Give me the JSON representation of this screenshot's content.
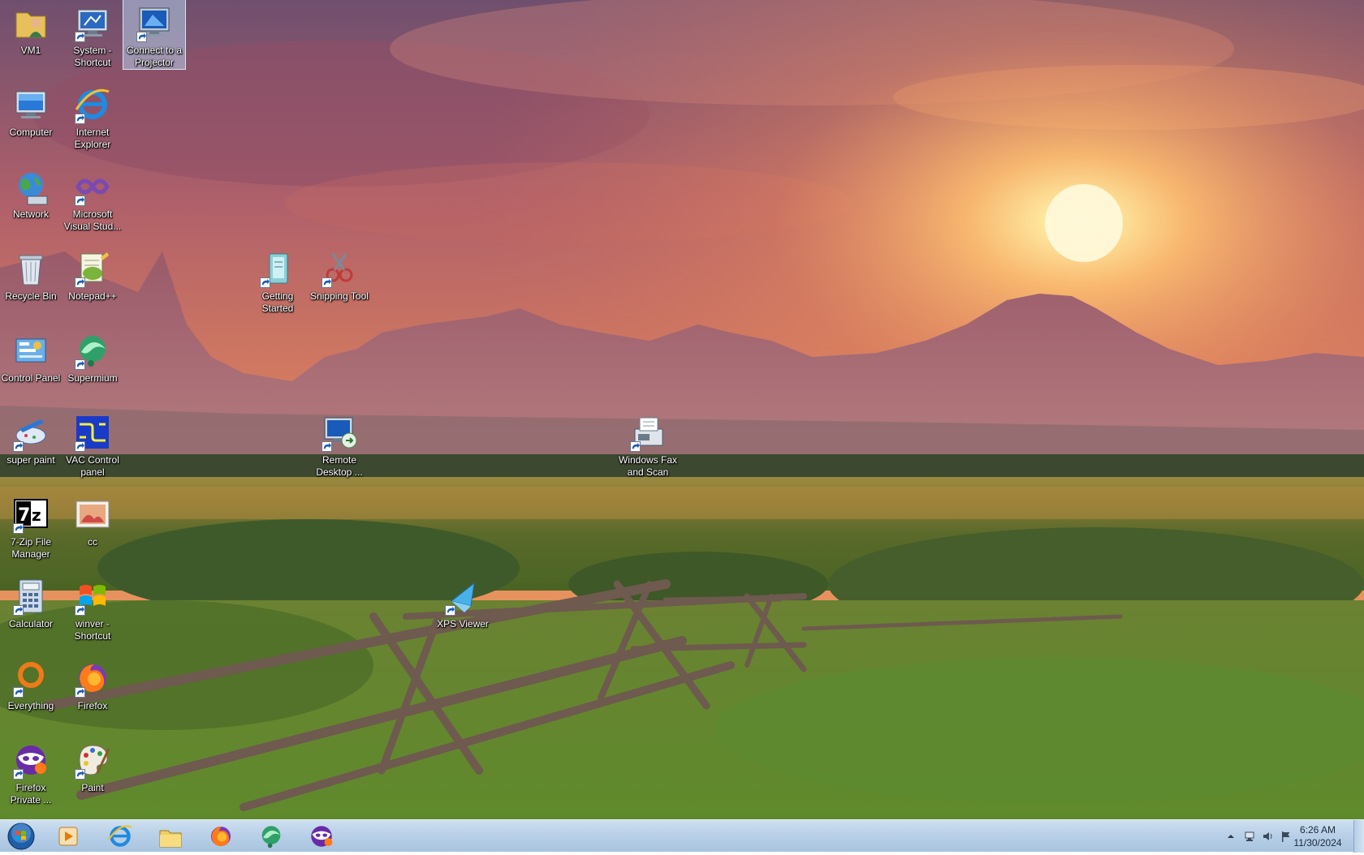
{
  "desktop": {
    "icons": [
      {
        "label": "VM1",
        "icon": "user-folder-icon",
        "shortcut": false,
        "selected": false
      },
      {
        "label": "System - Shortcut",
        "icon": "system-monitor-icon",
        "shortcut": true,
        "selected": false
      },
      {
        "label": "Connect to a Projector",
        "icon": "projector-monitor-icon",
        "shortcut": true,
        "selected": true
      },
      {
        "label": "Computer",
        "icon": "computer-icon",
        "shortcut": false,
        "selected": false
      },
      {
        "label": "Internet Explorer",
        "icon": "internet-explorer-icon",
        "shortcut": true,
        "selected": false
      },
      {
        "label": "Network",
        "icon": "network-globe-icon",
        "shortcut": false,
        "selected": false
      },
      {
        "label": "Microsoft Visual Stud...",
        "icon": "visual-studio-icon",
        "shortcut": true,
        "selected": false
      },
      {
        "label": "Recycle Bin",
        "icon": "recycle-bin-icon",
        "shortcut": false,
        "selected": false
      },
      {
        "label": "Notepad++",
        "icon": "notepad-plus-plus-icon",
        "shortcut": true,
        "selected": false
      },
      {
        "label": "Getting Started",
        "icon": "getting-started-icon",
        "shortcut": true,
        "selected": false
      },
      {
        "label": "Snipping Tool",
        "icon": "snipping-tool-icon",
        "shortcut": true,
        "selected": false
      },
      {
        "label": "Control Panel",
        "icon": "control-panel-icon",
        "shortcut": false,
        "selected": false
      },
      {
        "label": "Supermium",
        "icon": "supermium-icon",
        "shortcut": true,
        "selected": false
      },
      {
        "label": "super paint",
        "icon": "super-paint-icon",
        "shortcut": true,
        "selected": false
      },
      {
        "label": "VAC Control panel",
        "icon": "vac-control-icon",
        "shortcut": true,
        "selected": false
      },
      {
        "label": "Remote Desktop ...",
        "icon": "remote-desktop-icon",
        "shortcut": true,
        "selected": false
      },
      {
        "label": "Windows Fax and Scan",
        "icon": "fax-scan-icon",
        "shortcut": true,
        "selected": false
      },
      {
        "label": "7-Zip File Manager",
        "icon": "seven-zip-icon",
        "shortcut": true,
        "selected": false
      },
      {
        "label": "cc",
        "icon": "image-file-icon",
        "shortcut": false,
        "selected": false
      },
      {
        "label": "Calculator",
        "icon": "calculator-icon",
        "shortcut": true,
        "selected": false
      },
      {
        "label": "winver - Shortcut",
        "icon": "windows-flag-icon",
        "shortcut": true,
        "selected": false
      },
      {
        "label": "XPS Viewer",
        "icon": "xps-viewer-icon",
        "shortcut": true,
        "selected": false
      },
      {
        "label": "Everything",
        "icon": "everything-search-icon",
        "shortcut": true,
        "selected": false
      },
      {
        "label": "Firefox",
        "icon": "firefox-icon",
        "shortcut": true,
        "selected": false
      },
      {
        "label": "Firefox Private ...",
        "icon": "firefox-private-icon",
        "shortcut": true,
        "selected": false
      },
      {
        "label": "Paint",
        "icon": "paint-palette-icon",
        "shortcut": true,
        "selected": false
      }
    ]
  },
  "taskbar": {
    "start": "start-orb-icon",
    "pinned": [
      {
        "name": "media-player-icon"
      },
      {
        "name": "internet-explorer-icon"
      },
      {
        "name": "file-explorer-icon"
      },
      {
        "name": "firefox-icon"
      },
      {
        "name": "supermium-icon"
      },
      {
        "name": "firefox-private-icon"
      }
    ],
    "tray": {
      "icons": [
        "show-hidden-icons-arrow",
        "network-icon",
        "volume-icon",
        "action-center-flag-icon"
      ],
      "time": "6:26 AM",
      "date": "11/30/2024"
    }
  }
}
